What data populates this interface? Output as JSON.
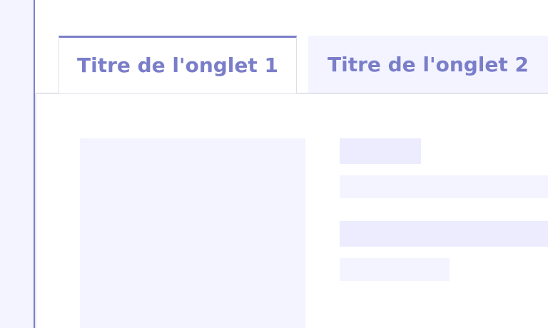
{
  "tabs": [
    {
      "label": "Titre de l'onglet 1",
      "selected": true
    },
    {
      "label": "Titre de l'onglet 2",
      "selected": false
    }
  ],
  "colors": {
    "accent": "#7a7ec9",
    "rail_background": "#f3f4ff",
    "placeholder_light": "#f3f4ff",
    "placeholder_medium": "#ececfe",
    "divider": "#e3e4ec"
  }
}
